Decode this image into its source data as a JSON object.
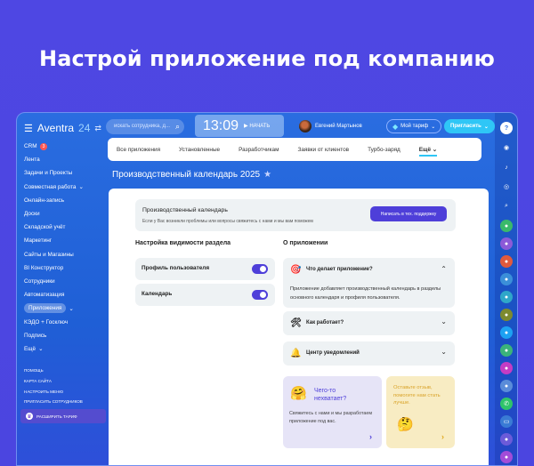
{
  "headline": "Настрой приложение под компанию",
  "topbar": {
    "logo_name": "Aventra",
    "logo_num": "24",
    "search_placeholder": "искать сотрудника, д...",
    "clock_time": "13:09",
    "clock_start": "НАЧАТЬ",
    "user_name": "Евгений Мартынов",
    "tariff_label": "Мой тариф",
    "invite_label": "Пригласить"
  },
  "sidebar": {
    "items": [
      {
        "label": "CRM",
        "badge": "3"
      },
      {
        "label": "Лента"
      },
      {
        "label": "Задачи и Проекты"
      },
      {
        "label": "Совместная работа"
      },
      {
        "label": "Онлайн-запись"
      },
      {
        "label": "Доски"
      },
      {
        "label": "Складской учёт"
      },
      {
        "label": "Маркетинг"
      },
      {
        "label": "Сайты и Магазины"
      },
      {
        "label": "BI Конструктор"
      },
      {
        "label": "Сотрудники"
      },
      {
        "label": "Автоматизация"
      },
      {
        "label": "Приложения"
      },
      {
        "label": "КЭДО + Госключ"
      },
      {
        "label": "Подпись"
      },
      {
        "label": "Ещё"
      }
    ],
    "small": [
      "ПОМОЩЬ",
      "КАРТА САЙТА",
      "НАСТРОИТЬ МЕНЮ",
      "ПРИГЛАСИТЬ СОТРУДНИКОВ"
    ],
    "upgrade": "РАСШИРИТЬ ТАРИФ"
  },
  "tabs": [
    "Все приложения",
    "Установленные",
    "Разработчикам",
    "Заявки от клиентов",
    "Турбо-заряд",
    "Ещё"
  ],
  "page_title": "Производственный календарь 2025",
  "info": {
    "title": "Производственный календарь",
    "text": "Если у Вас возникли проблемы или вопросы свяжитесь с нами и мы вам поможем",
    "button": "Написать в тех. поддержку"
  },
  "visibility": {
    "title": "Настройка видимости раздела",
    "rows": [
      {
        "label": "Профиль пользователя",
        "enabled": true
      },
      {
        "label": "Календарь",
        "enabled": true
      }
    ]
  },
  "about": {
    "title": "О приложении",
    "items": [
      {
        "title": "Что делает приложение?",
        "body": "Приложение добавляет производственный календарь в разделы основного календаря и профиля пользователя."
      },
      {
        "title": "Как работает?"
      },
      {
        "title": "Центр уведомлений"
      }
    ]
  },
  "cards": {
    "purple": {
      "question": "Чего-то нехватает?",
      "desc": "Свяжитесь с нами и мы разработаем приложение под вас."
    },
    "yellow": {
      "question": "Оставьте отзыв, помогите нам стать лучше."
    }
  },
  "colors": {
    "background": "#4e47e3",
    "accent": "#4e3fd9",
    "invite": "#2fc6f6"
  }
}
